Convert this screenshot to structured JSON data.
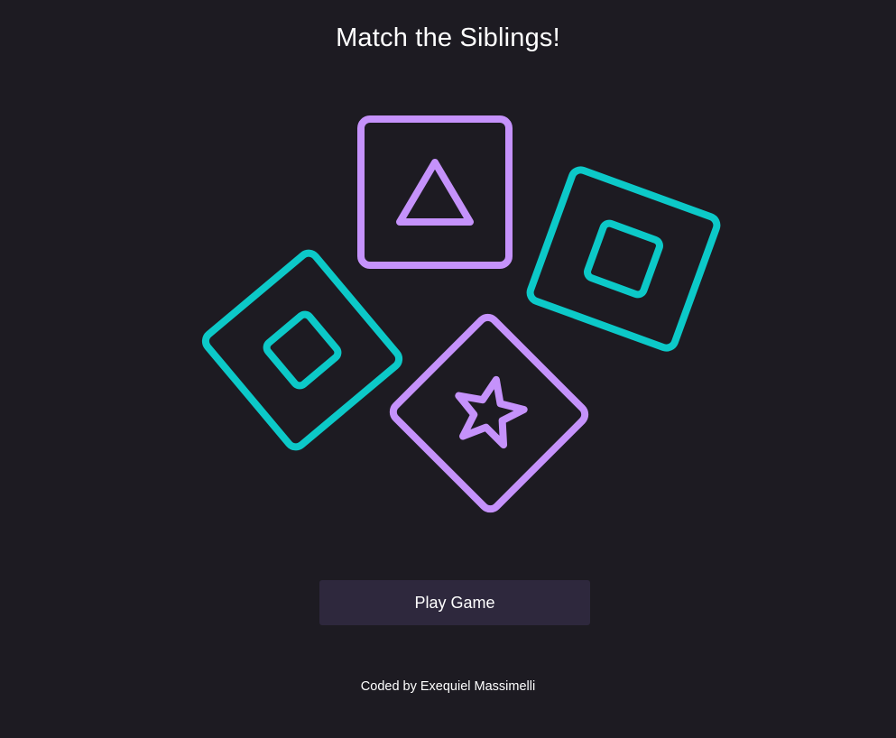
{
  "header": {
    "title": "Match the Siblings!"
  },
  "cards": [
    {
      "name": "card-triangle",
      "symbol": "triangle",
      "color": "#c592fb"
    },
    {
      "name": "card-square-right",
      "symbol": "square",
      "color": "#0cc9c8"
    },
    {
      "name": "card-square-left",
      "symbol": "square",
      "color": "#0cc9c8"
    },
    {
      "name": "card-star",
      "symbol": "star",
      "color": "#c592fb"
    }
  ],
  "actions": {
    "play_label": "Play Game"
  },
  "footer": {
    "credit": "Coded by Exequiel Massimelli"
  },
  "colors": {
    "background": "#1d1b22",
    "purple": "#c592fb",
    "teal": "#0cc9c8",
    "button": "#2e283d",
    "text": "#ffffff"
  }
}
